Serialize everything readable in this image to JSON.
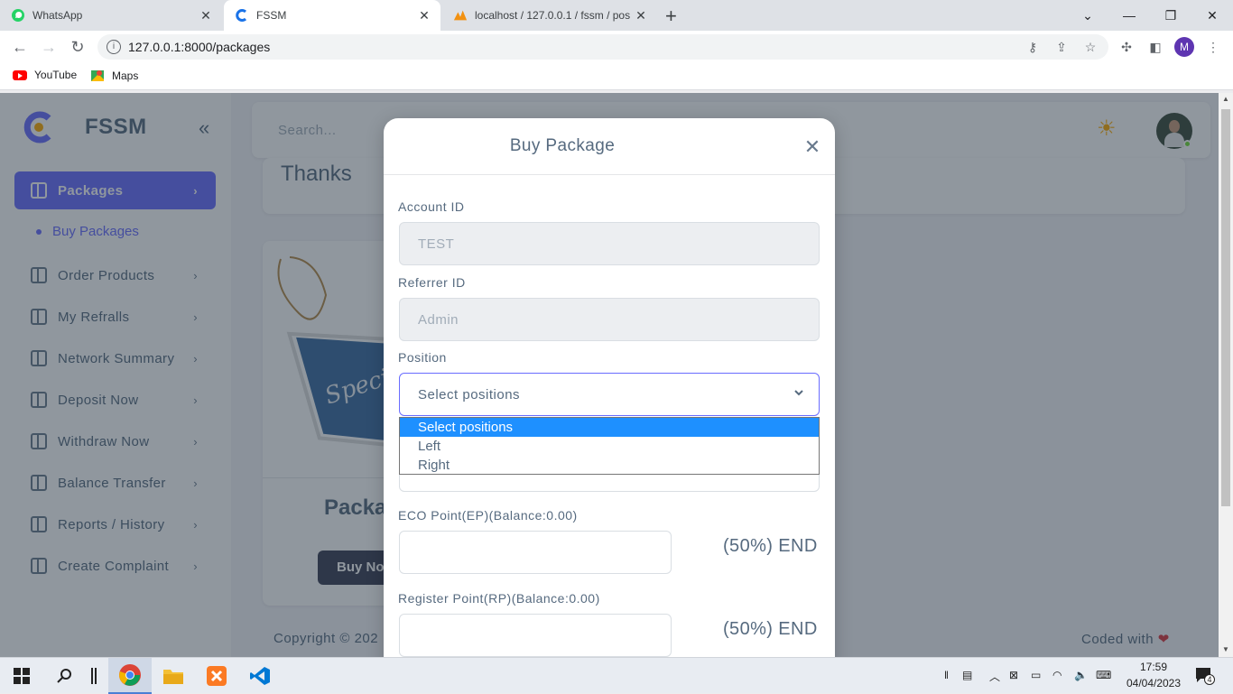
{
  "browser": {
    "tabs": [
      {
        "title": "WhatsApp",
        "favicon": "whatsapp-icon"
      },
      {
        "title": "FSSM",
        "favicon": "app-logo-icon"
      },
      {
        "title": "localhost / 127.0.0.1 / fssm / pos",
        "favicon": "phpmyadmin-icon"
      }
    ],
    "url": "127.0.0.1:8000/packages",
    "profile_initial": "M",
    "bookmarks": [
      {
        "label": "YouTube",
        "icon": "youtube-icon"
      },
      {
        "label": "Maps",
        "icon": "maps-icon"
      }
    ]
  },
  "sidebar": {
    "brand": "FSSM",
    "active_item": "Packages",
    "sub_item": "Buy Packages",
    "items": [
      "Order Products",
      "My Refralls",
      "Network Summary",
      "Deposit Now",
      "Withdraw Now",
      "Balance Transfer",
      "Reports / History",
      "Create Complaint"
    ]
  },
  "navbar": {
    "search_placeholder": "Search..."
  },
  "background": {
    "thanks_text": "Thanks",
    "package_title": "Packa",
    "buy_button": "Buy Nov",
    "card_image_text": "Special",
    "copyright": "Copyright © 202",
    "coded_with": "Coded with"
  },
  "modal": {
    "title": "Buy Package",
    "fields": {
      "account_id_label": "Account ID",
      "account_id_value": "TEST",
      "referrer_id_label": "Referrer ID",
      "referrer_id_value": "Admin",
      "position_label": "Position",
      "position_value": "Select positions",
      "eco_label": "ECO Point(EP)(Balance:0.00)",
      "eco_suffix": "(50%) END",
      "register_label": "Register Point(RP)(Balance:0.00)",
      "register_suffix": "(50%) END"
    },
    "position_options": [
      "Select positions",
      "Left",
      "Right"
    ]
  },
  "taskbar": {
    "time": "17:59",
    "date": "04/04/2023",
    "notifications": "4"
  },
  "colors": {
    "primary": "#696cff",
    "heart": "#d9363e"
  }
}
